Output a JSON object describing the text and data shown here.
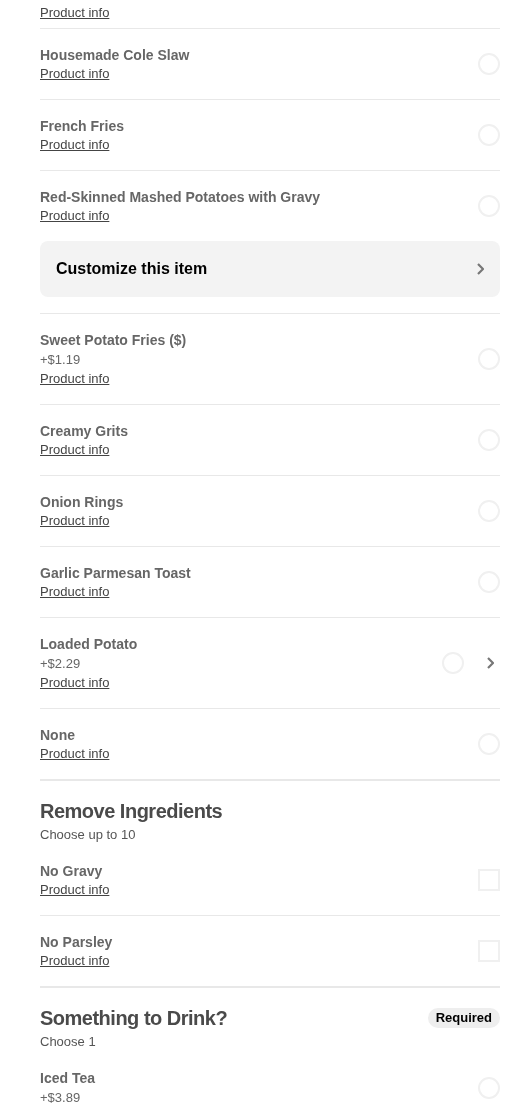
{
  "sections": [
    {
      "items": [
        {
          "info": "Product info"
        },
        {
          "kind": "radio",
          "name": "Housemade Cole Slaw",
          "info": "Product info",
          "selected": false,
          "has_submenu": false
        },
        {
          "kind": "radio",
          "name": "French Fries",
          "info": "Product info",
          "selected": false,
          "has_submenu": false
        },
        {
          "kind": "radio",
          "name": "Red-Skinned Mashed Potatoes with Gravy",
          "info": "Product info",
          "selected": false,
          "has_submenu": false,
          "customize": "Customize this item"
        },
        {
          "kind": "radio",
          "name": "Sweet Potato Fries ($)",
          "price": "+$1.19",
          "info": "Product info",
          "selected": false,
          "has_submenu": false
        },
        {
          "kind": "radio",
          "name": "Creamy Grits",
          "info": "Product info",
          "selected": false,
          "has_submenu": false
        },
        {
          "kind": "radio",
          "name": "Onion Rings",
          "info": "Product info",
          "selected": false,
          "has_submenu": false
        },
        {
          "kind": "radio",
          "name": "Garlic Parmesan Toast",
          "info": "Product info",
          "selected": false,
          "has_submenu": false
        },
        {
          "kind": "radio",
          "name": "Loaded Potato",
          "price": "+$2.29",
          "info": "Product info",
          "selected": false,
          "has_submenu": true
        },
        {
          "kind": "radio",
          "name": "None",
          "info": "Product info",
          "selected": false,
          "has_submenu": false
        }
      ]
    },
    {
      "title": "Remove Ingredients",
      "subtitle": "Choose up to 10",
      "items": [
        {
          "kind": "checkbox",
          "name": "No Gravy",
          "info": "Product info",
          "selected": false,
          "has_submenu": false
        },
        {
          "kind": "checkbox",
          "name": "No Parsley",
          "info": "Product info",
          "selected": false,
          "has_submenu": false
        }
      ]
    },
    {
      "title": "Something to Drink?",
      "subtitle": "Choose 1",
      "badge": "Required",
      "items": [
        {
          "kind": "radio",
          "name": "Iced Tea",
          "price": "+$3.89",
          "selected": false,
          "has_submenu": false
        }
      ]
    }
  ]
}
